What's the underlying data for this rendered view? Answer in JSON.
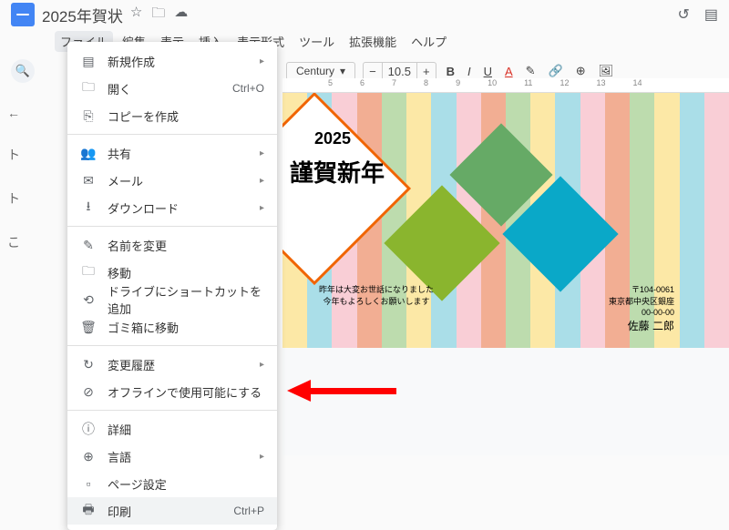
{
  "doc": {
    "title": "2025年賀状"
  },
  "menubar": [
    "ファイル",
    "編集",
    "表示",
    "挿入",
    "表示形式",
    "ツール",
    "拡張機能",
    "ヘルプ"
  ],
  "toolbar": {
    "font": "Century",
    "size": "10.5"
  },
  "menu": {
    "new": "新規作成",
    "open": "開く",
    "open_shortcut": "Ctrl+O",
    "copy": "コピーを作成",
    "share": "共有",
    "mail": "メール",
    "download": "ダウンロード",
    "rename": "名前を変更",
    "move": "移動",
    "drive_shortcut": "ドライブにショートカットを追加",
    "trash": "ゴミ箱に移動",
    "history": "変更履歴",
    "offline": "オフラインで使用可能にする",
    "details": "詳細",
    "language": "言語",
    "page_setup": "ページ設定",
    "print": "印刷",
    "print_shortcut": "Ctrl+P"
  },
  "ruler": [
    "5",
    "6",
    "7",
    "8",
    "9",
    "10",
    "11",
    "12",
    "13",
    "14"
  ],
  "card": {
    "year": "2025",
    "greeting": "謹賀新年",
    "msg1": "昨年は大変お世話になりました",
    "msg2": "今年もよろしくお願いします",
    "zip": "〒104-0061",
    "addr": "東京都中央区銀座",
    "addr2": "00-00-00",
    "name": "佐藤 二郎"
  },
  "sidebar": {
    "t1": "ト",
    "t2": "ト",
    "t3": "こ"
  },
  "stripe_colors": [
    "#F9D65C",
    "#65C3D6",
    "#F4A6B4",
    "#E86C3A",
    "#86C06C",
    "#F9D65C",
    "#65C3D6",
    "#F4A6B4",
    "#E86C3A",
    "#86C06C",
    "#F9D65C",
    "#65C3D6",
    "#F4A6B4",
    "#E86C3A",
    "#86C06C",
    "#F9D65C",
    "#65C3D6",
    "#F4A6B4"
  ]
}
